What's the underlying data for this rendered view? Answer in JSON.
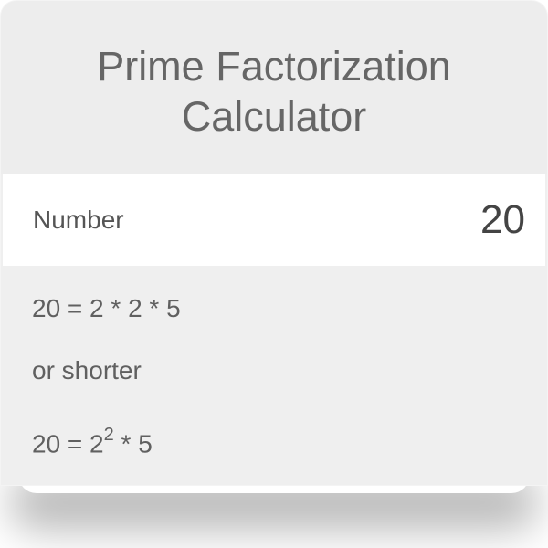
{
  "header": {
    "title_line1": "Prime Factorization",
    "title_line2": "Calculator"
  },
  "input": {
    "label": "Number",
    "value": "20"
  },
  "results": {
    "full": "20 = 2 * 2 * 5",
    "connector": "or shorter",
    "short_prefix": "20 = 2",
    "short_exponent": "2",
    "short_suffix": " * 5"
  },
  "colors": {
    "card_bg": "#efefef",
    "input_bg": "#ffffff",
    "text": "#666666"
  }
}
